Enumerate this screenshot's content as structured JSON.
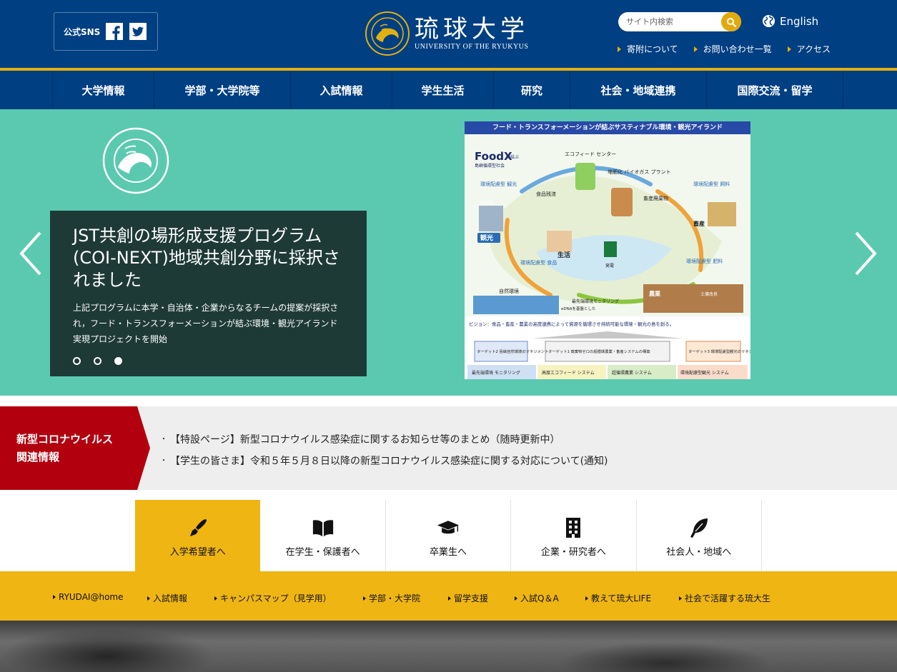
{
  "header": {
    "sns_label": "公式SNS",
    "logo_jp": "琉球大学",
    "logo_en": "UNIVERSITY OF THE RYUKYUS",
    "search_placeholder": "サイト内検索",
    "english_label": "English",
    "links": [
      "寄附について",
      "お問い合わせ一覧",
      "アクセス"
    ]
  },
  "nav": {
    "items": [
      "大学情報",
      "学部・大学院等",
      "入試情報",
      "学生生活",
      "研究",
      "社会・地域連携",
      "国際交流・留学"
    ]
  },
  "hero": {
    "title": "JST共創の場形成支援プログラム(COI-NEXT)地域共創分野に採択されました",
    "description": "上記プログラムに本学・自治体・企業からなるチームの提案が採択され，フード・トランスフォーメーションが結ぶ環境・観光アイランド実現プロジェクトを開始",
    "active_slide": 3,
    "slide_count": 3,
    "info_title": "フード・トランスフォーメーションが結ぶサスティナブル環境・観光アイランド",
    "info_vision": "ビジョン：食品・畜産・農業の高度連携によって資源を循環させ持続可能な環境・観光の島を創る。",
    "info_labels": {
      "brand": "FoodX",
      "brand_sub": "が結ぶ",
      "society": "島嶼循環型社会",
      "center": "エコフィード センター",
      "biogas": "堆肥化 バイオガス プラント",
      "food_waste": "食品残渣",
      "livestock_waste": "畜産廃棄物",
      "tourism": "観光",
      "tourism_type": "環境配慮型 観光",
      "hotel": "HOTEL",
      "life": "生活",
      "power": "発電",
      "food": "環境配慮型 食品",
      "nature": "自然環境",
      "feed": "環境配慮型 飼料",
      "livestock": "畜産",
      "fertilizer": "環境配慮型 肥料",
      "agri": "農業",
      "soil": "土壌改良",
      "monitoring": "最先端環境モニタリング",
      "edna": "eDNAを基盤とした"
    },
    "targets": [
      "ターゲット2 島嶼自然環境のマネジメント",
      "ターゲット1 廃棄物ゼロの超循環農業・畜産システムの構築",
      "ターゲット3 環境配慮型観光のマネジメント"
    ],
    "systems": [
      "最先端環境 モニタリング",
      "高度エコフィード システム",
      "超循環農業 システム",
      "環境配慮型観光 システム"
    ]
  },
  "corona": {
    "label_line1": "新型コロナウイルス",
    "label_line2": "関連情報",
    "links": [
      "【特設ページ】新型コロナウイルス感染症に関するお知らせ等のまとめ（随時更新中）",
      "【学生の皆さま】令和５年５月８日以降の新型コロナウイルス感染症に関する対応について(通知)"
    ],
    "accent": "#b3000f"
  },
  "tabs": [
    {
      "label": "入学希望者へ",
      "icon": "pen-icon"
    },
    {
      "label": "在学生・保護者へ",
      "icon": "book-icon"
    },
    {
      "label": "卒業生へ",
      "icon": "graduation-cap-icon"
    },
    {
      "label": "企業・研究者へ",
      "icon": "building-icon"
    },
    {
      "label": "社会人・地域へ",
      "icon": "feather-icon"
    }
  ],
  "quick_links": [
    "RYUDAI@home",
    "入試情報",
    "キャンパスマップ（見学用）",
    "学部・大学院",
    "留学支援",
    "入試Q＆A",
    "教えて琉大LIFE",
    "社会で活躍する琉大生"
  ],
  "colors": {
    "header_blue": "#003f82",
    "gold": "#e2b010",
    "hero_teal": "#5bc9b0",
    "caption_dark": "#1e3a36",
    "tab_yellow": "#efb513"
  }
}
